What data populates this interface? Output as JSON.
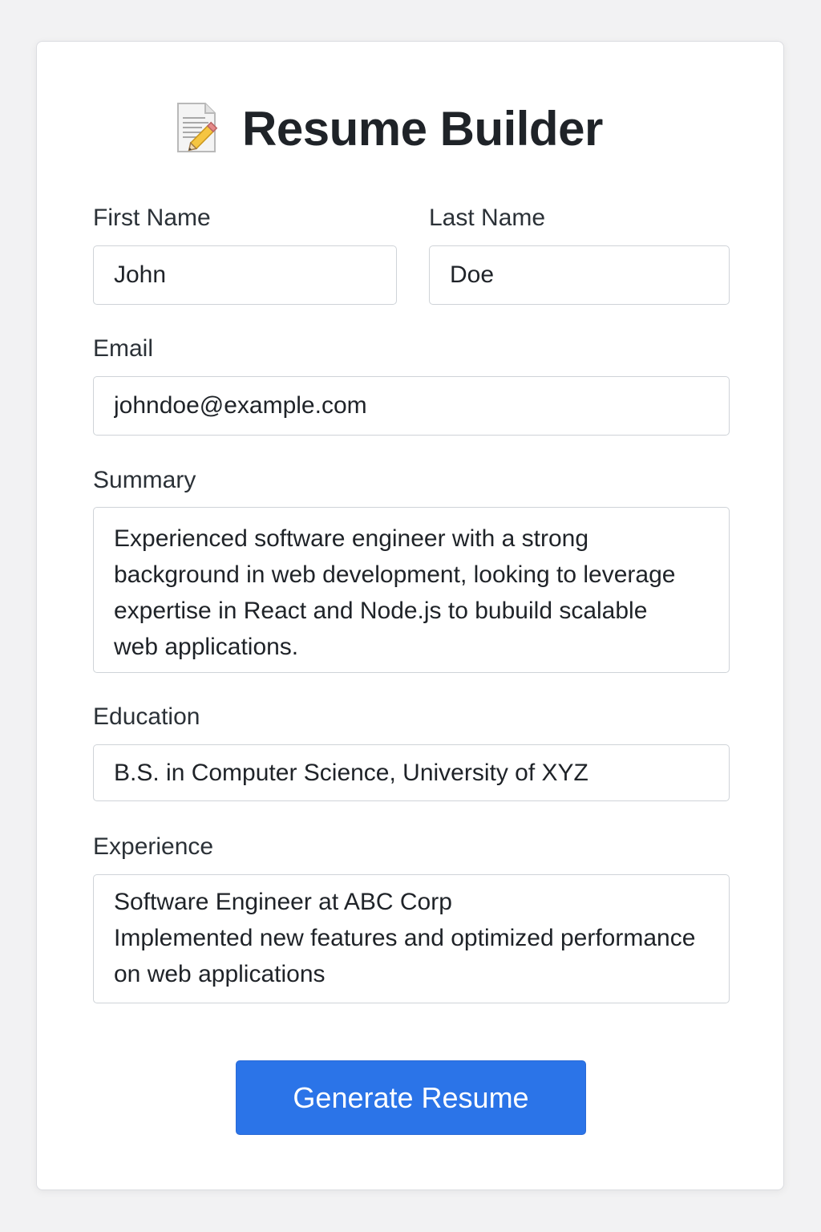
{
  "app": {
    "title": "Resume Builder",
    "icon": "document-pencil-icon"
  },
  "form": {
    "first_name": {
      "label": "First Name",
      "value": "John"
    },
    "last_name": {
      "label": "Last Name",
      "value": "Doe"
    },
    "email": {
      "label": "Email",
      "value": "johndoe@example.com"
    },
    "summary": {
      "label": "Summary",
      "value": "Experienced software engineer with a strong background in web development, looking to leverage expertise in React and Node.js to bubuild scalable web applications."
    },
    "education": {
      "label": "Education",
      "value": "B.S. in Computer Science, University of XYZ"
    },
    "experience": {
      "label": "Experience",
      "value": "Software Engineer at ABC Corp\nImplemented new features and optimized performance on web applications"
    }
  },
  "actions": {
    "generate_label": "Generate Resume"
  },
  "colors": {
    "page_background": "#f2f2f3",
    "card_background": "#ffffff",
    "primary_button": "#2b74e8",
    "text": "#1f2328",
    "field_border": "#cfd3d8"
  }
}
